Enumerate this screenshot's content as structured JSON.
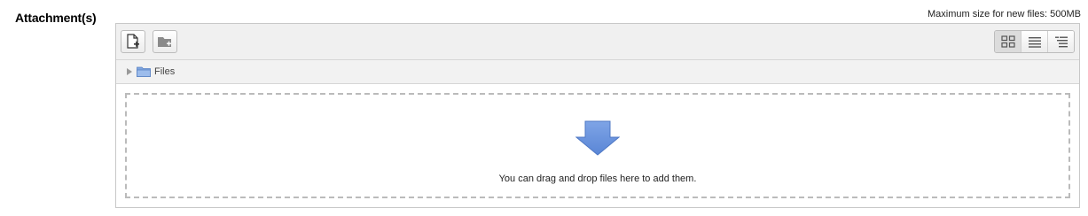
{
  "field": {
    "label": "Attachment(s)",
    "max_size_text": "Maximum size for new files: 500MB"
  },
  "toolbar": {
    "add_file_icon": "add-file-icon",
    "create_folder_icon": "create-folder-icon",
    "views": [
      {
        "icon": "view-icons-icon",
        "active": true
      },
      {
        "icon": "view-list-icon",
        "active": false
      },
      {
        "icon": "view-tree-icon",
        "active": false
      }
    ]
  },
  "path": {
    "folder_label": "Files"
  },
  "dropzone": {
    "message": "You can drag and drop files here to add them.",
    "arrow_color": "#6e93d9"
  },
  "colors": {
    "border": "#c8c8c8",
    "toolbar_bg": "#f0f0f0",
    "folder_blue": "#7fa6e0"
  }
}
